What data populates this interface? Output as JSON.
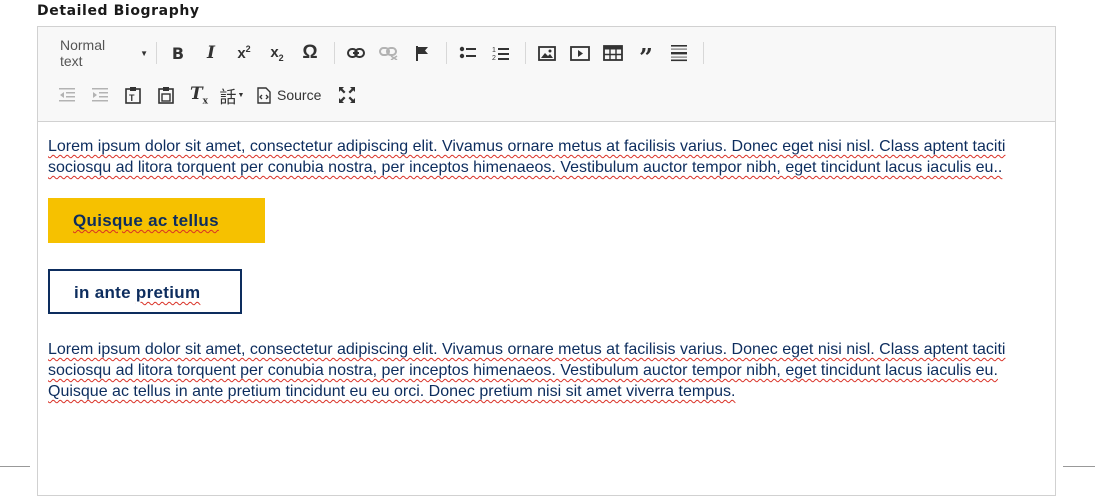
{
  "field": {
    "label": "Detailed Biography"
  },
  "toolbar": {
    "format_combo": "Normal text",
    "source_label": "Source"
  },
  "icons": {
    "bold": "B",
    "italic": "I",
    "superscript": "x²",
    "subscript": "x₂",
    "special_char": "Ω",
    "quote": "99",
    "language": "話"
  },
  "content": {
    "paragraph1": "Lorem ipsum dolor sit amet, consectetur adipiscing elit. Vivamus ornare metus at facilisis varius. Donec eget nisi nisl. Class aptent taciti sociosqu ad litora torquent per conubia nostra, per inceptos himenaeos. Vestibulum auctor tempor nibh, eget tincidunt lacus iaculis eu..",
    "button_yellow": "Quisque ac tellus",
    "button_outline": "in ante pretium",
    "paragraph2": "Lorem ipsum dolor sit amet, consectetur adipiscing elit. Vivamus ornare metus at facilisis varius. Donec eget nisi nisl. Class aptent taciti sociosqu ad litora torquent per conubia nostra, per inceptos himenaeos. Vestibulum auctor tempor nibh, eget tincidunt lacus iaculis eu. Quisque ac tellus in ante pretium tincidunt eu eu orci. Donec pretium nisi sit amet viverra tempus."
  },
  "colors": {
    "text": "#0d2d5e",
    "yellow_button": "#f6c100",
    "spellcheck": "#d93025",
    "toolbar_bg": "#f8f8f8"
  }
}
